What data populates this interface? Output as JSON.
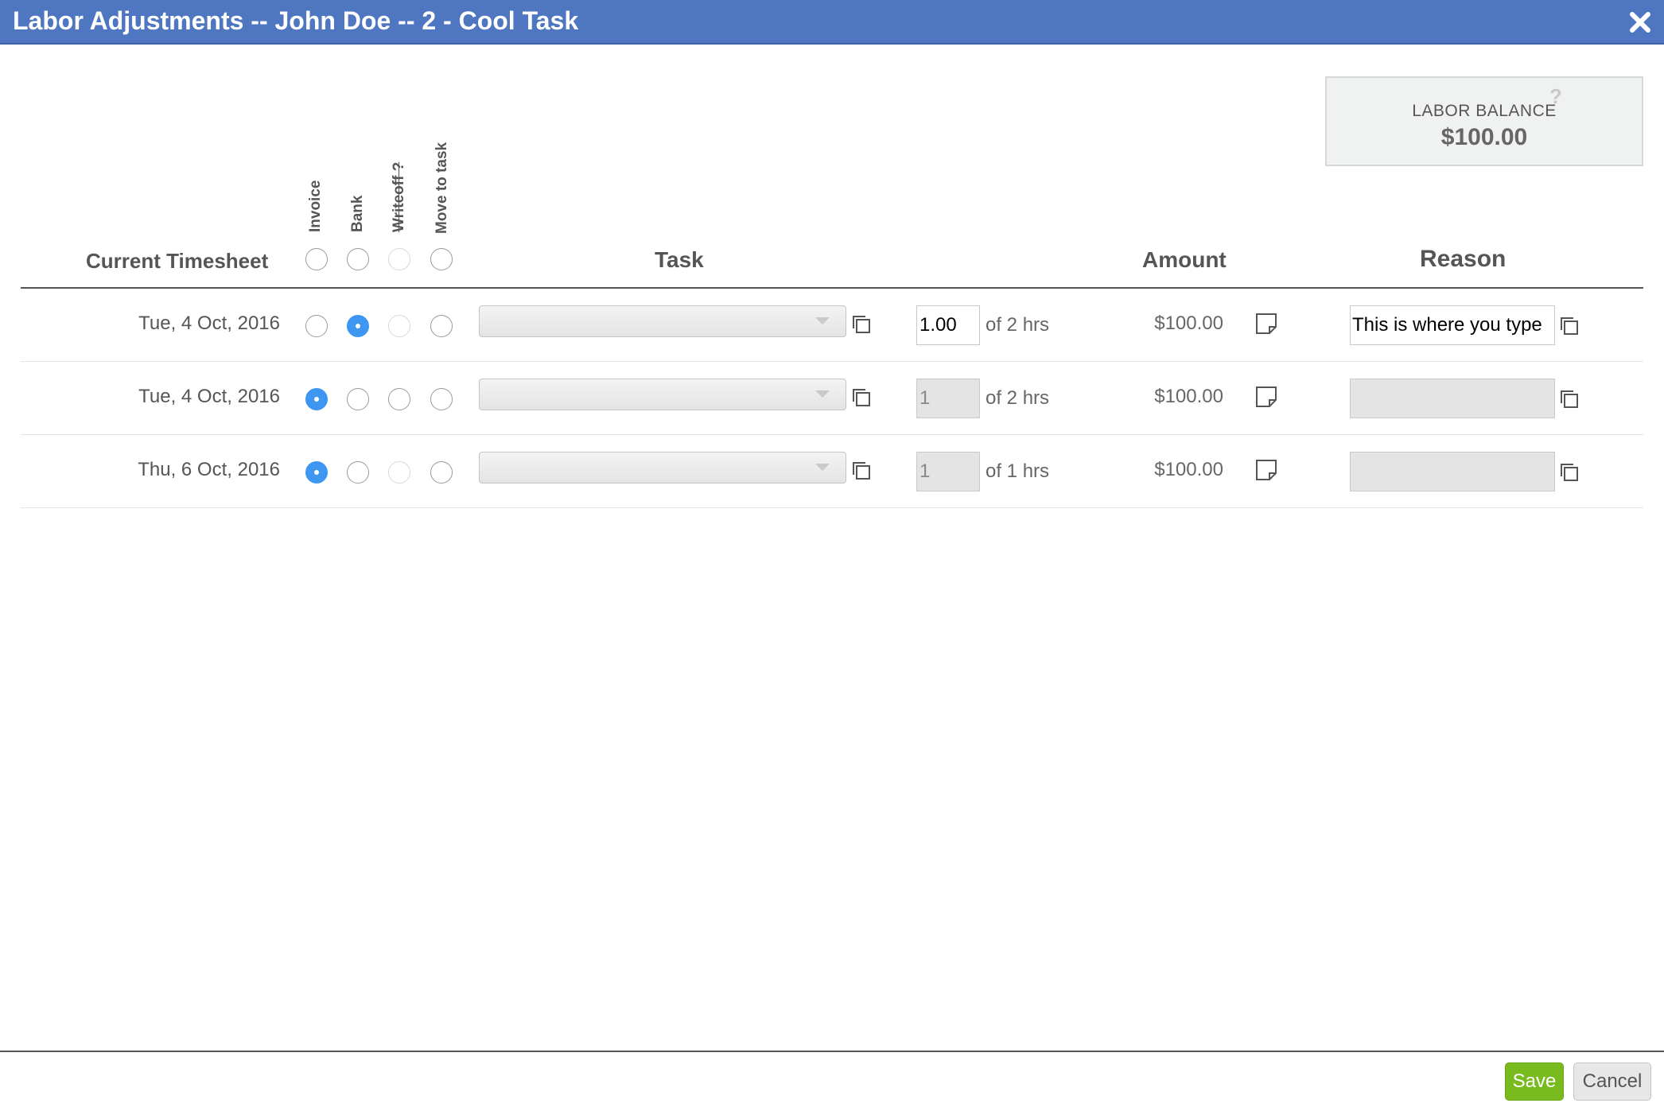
{
  "window": {
    "title": "Labor Adjustments -- John Doe -- 2 - Cool Task",
    "close_icon": "close-x-icon"
  },
  "balance": {
    "label": "LABOR BALANCE",
    "value": "$100.00",
    "help": "?"
  },
  "columns": {
    "current_timesheet": "Current Timesheet",
    "invoice": "Invoice",
    "bank": "Bank",
    "writeoff": "Writeoff ?",
    "move_to_task": "Move to task",
    "task": "Task",
    "amount": "Amount",
    "reason": "Reason"
  },
  "rows": [
    {
      "date": "Tue, 4 Oct, 2016",
      "selected_option": "bank",
      "task_value": "",
      "hours_value": "1.00",
      "hours_of": "of 2 hrs",
      "amount": "$100.00",
      "reason_value": "This is where you type",
      "hours_editable": true,
      "reason_editable": true
    },
    {
      "date": "Tue, 4 Oct, 2016",
      "selected_option": "invoice",
      "task_value": "",
      "hours_value": "1",
      "hours_of": "of 2 hrs",
      "amount": "$100.00",
      "reason_value": "",
      "hours_editable": false,
      "reason_editable": false
    },
    {
      "date": "Thu, 6 Oct, 2016",
      "selected_option": "invoice",
      "task_value": "",
      "hours_value": "1",
      "hours_of": "of 1 hrs",
      "amount": "$100.00",
      "reason_value": "",
      "hours_editable": false,
      "reason_editable": false
    }
  ],
  "footer": {
    "save_label": "Save",
    "cancel_label": "Cancel"
  },
  "colors": {
    "titlebar": "#4f76c0",
    "radio_checked": "#3d97f2",
    "save_button": "#79ba1f"
  }
}
